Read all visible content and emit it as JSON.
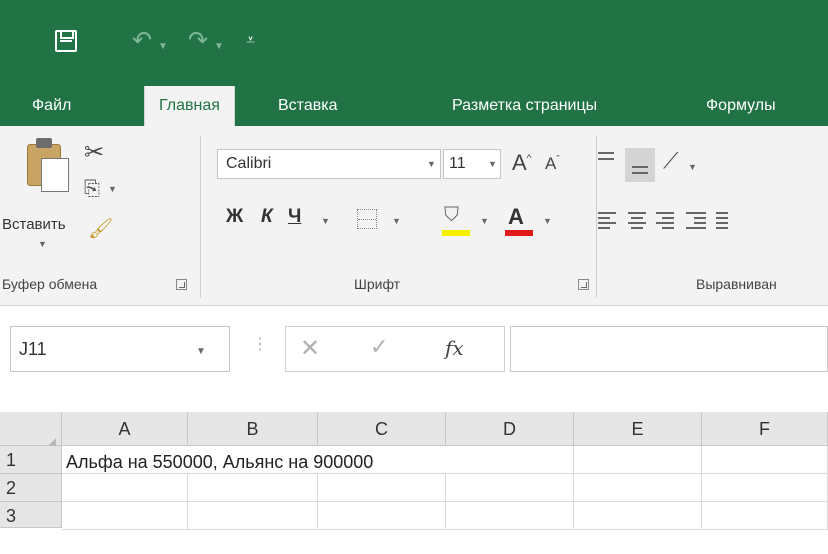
{
  "window": {
    "accent_color": "#217346",
    "qat": {
      "save_icon": "save-icon",
      "undo_icon": "undo-icon",
      "redo_icon": "redo-icon",
      "customize_icon": "customize-qat-icon"
    }
  },
  "tabs": [
    {
      "label": "Файл",
      "active": false
    },
    {
      "label": "Главная",
      "active": true
    },
    {
      "label": "Вставка",
      "active": false
    },
    {
      "label": "Разметка страницы",
      "active": false
    },
    {
      "label": "Формулы",
      "active": false
    }
  ],
  "ribbon": {
    "clipboard": {
      "paste_label": "Вставить",
      "group_label": "Буфер обмена"
    },
    "font": {
      "font_name": "Calibri",
      "font_size": "11",
      "grow_label": "A",
      "shrink_label": "A",
      "bold_label": "Ж",
      "italic_label": "К",
      "underline_label": "Ч",
      "font_color_label": "A",
      "fill_color": "#f4f000",
      "font_color": "#e11a1a",
      "group_label": "Шрифт"
    },
    "alignment": {
      "group_label": "Выравниван"
    }
  },
  "formula_bar": {
    "name_box": "J11",
    "fx_label": "fx",
    "formula": ""
  },
  "sheet": {
    "columns": [
      "A",
      "B",
      "C",
      "D",
      "E",
      "F"
    ],
    "rows": [
      "1",
      "2",
      "3"
    ],
    "cells": {
      "A1": "Альфа на 550000, Альянс на 900000"
    }
  }
}
